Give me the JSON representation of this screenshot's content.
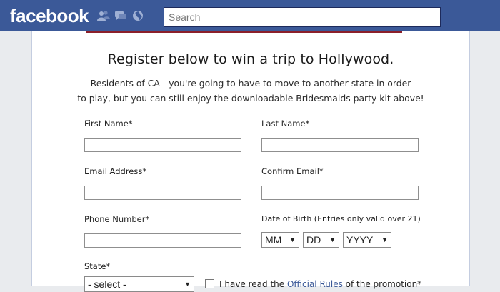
{
  "header": {
    "logo": "facebook",
    "search_placeholder": "Search",
    "icons": [
      "friends-icon",
      "messages-icon",
      "notifications-globe-icon"
    ]
  },
  "form": {
    "title": "Register below to win a trip to Hollywood.",
    "notice_line1": "Residents of CA - you're going to have to move to another state in order",
    "notice_line2": "to play, but you can still enjoy the downloadable Bridesmaids party kit above!",
    "first_name_label": "First Name*",
    "last_name_label": "Last Name*",
    "email_label": "Email Address*",
    "confirm_email_label": "Confirm Email*",
    "phone_label": "Phone Number*",
    "dob_label": "Date of Birth (Entries only valid over 21)",
    "dob_month": "MM",
    "dob_day": "DD",
    "dob_year": "YYYY",
    "state_label": "State*",
    "state_value": "- select -",
    "terms_prefix": "I have read the ",
    "terms_link": "Official Rules",
    "terms_suffix": " of the promotion*"
  },
  "colors": {
    "brand": "#3b5998",
    "accent_line": "#8b1f2a"
  }
}
